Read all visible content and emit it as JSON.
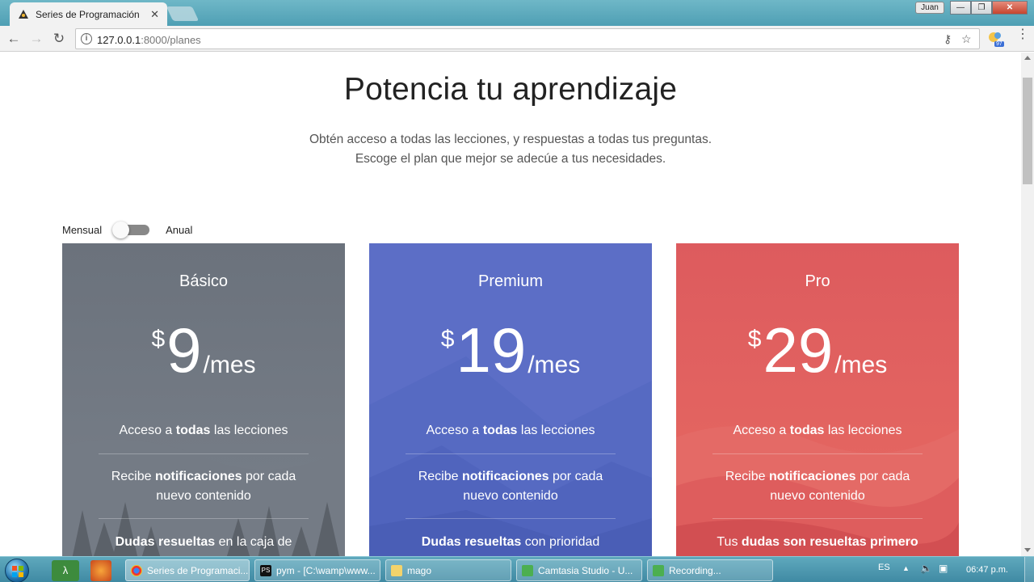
{
  "browser": {
    "tab_title": "Series de Programación",
    "tab_close": "✕",
    "url_host": "127.0.0.1",
    "url_path": ":8000/planes",
    "user_label": "Juan",
    "extension_badge": "97"
  },
  "page": {
    "title": "Potencia tu aprendizaje",
    "subtitle_line1": "Obtén acceso a todas las lecciones, y respuestas a todas tus preguntas.",
    "subtitle_line2": "Escoge el plan que mejor se adecúe a tus necesidades."
  },
  "billing_toggle": {
    "monthly_label": "Mensual",
    "annual_label": "Anual",
    "selected": "Mensual"
  },
  "plans": [
    {
      "name": "Básico",
      "currency": "$",
      "price": "9",
      "period": "/mes",
      "color": "#6b737d",
      "features": [
        {
          "pre": "Acceso a ",
          "bold": "todas",
          "post": " las lecciones"
        },
        {
          "pre": "Recibe ",
          "bold": "notificaciones",
          "post": " por cada nuevo contenido"
        },
        {
          "pre": "",
          "bold": "Dudas resueltas",
          "post": " en la caja de"
        }
      ]
    },
    {
      "name": "Premium",
      "currency": "$",
      "price": "19",
      "period": "/mes",
      "color": "#5a6dc4",
      "features": [
        {
          "pre": "Acceso a ",
          "bold": "todas",
          "post": " las lecciones"
        },
        {
          "pre": "Recibe ",
          "bold": "notificaciones",
          "post": " por cada nuevo contenido"
        },
        {
          "pre": "",
          "bold": "Dudas resueltas",
          "post": " con prioridad"
        }
      ]
    },
    {
      "name": "Pro",
      "currency": "$",
      "price": "29",
      "period": "/mes",
      "color": "#e05a5a",
      "features": [
        {
          "pre": "Acceso a ",
          "bold": "todas",
          "post": " las lecciones"
        },
        {
          "pre": "Recibe ",
          "bold": "notificaciones",
          "post": " por cada nuevo contenido"
        },
        {
          "pre": "Tus ",
          "bold": "dudas son resueltas primero",
          "post": ""
        }
      ]
    }
  ],
  "taskbar": {
    "tasks": [
      {
        "label": "Series de Programaci..."
      },
      {
        "label": "pym - [C:\\wamp\\www..."
      },
      {
        "label": "mago"
      },
      {
        "label": "Camtasia Studio - U..."
      },
      {
        "label": "Recording..."
      }
    ],
    "language": "ES",
    "clock": "06:47 p.m."
  }
}
